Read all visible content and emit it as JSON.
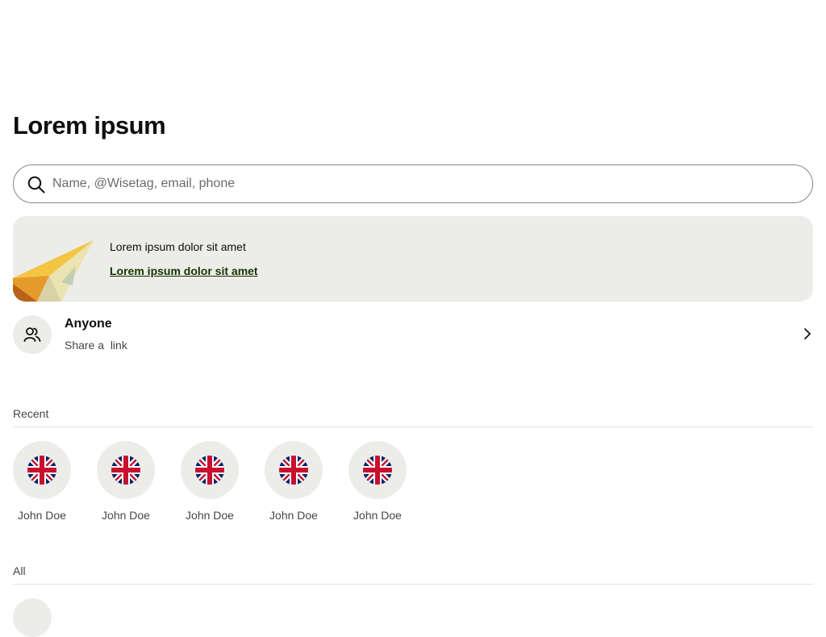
{
  "page": {
    "title": "Lorem ipsum"
  },
  "search": {
    "placeholder": "Name, @Wisetag, email, phone",
    "value": ""
  },
  "promo": {
    "text": "Lorem ipsum dolor sit amet",
    "link": "Lorem ipsum dolor sit amet"
  },
  "anyone": {
    "title": "Anyone",
    "subtitle": "Share a  link"
  },
  "recent": {
    "label": "Recent",
    "contacts": [
      {
        "name": "John Doe",
        "flag": "uk-flag-icon"
      },
      {
        "name": "John Doe",
        "flag": "uk-flag-icon"
      },
      {
        "name": "John Doe",
        "flag": "uk-flag-icon"
      },
      {
        "name": "John Doe",
        "flag": "uk-flag-icon"
      },
      {
        "name": "John Doe",
        "flag": "uk-flag-icon"
      }
    ]
  },
  "all": {
    "label": "All"
  },
  "colors": {
    "background": "#ffffff",
    "surface": "#ecede8",
    "text": "#0e0f0c",
    "muted": "#454745",
    "link": "#163300",
    "flag_blue": "#012169",
    "flag_red": "#c8102e"
  }
}
